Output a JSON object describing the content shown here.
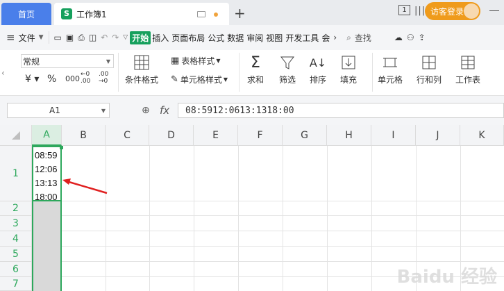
{
  "tabs": {
    "home": "首页",
    "doc_title": "工作簿1"
  },
  "titlebar": {
    "badge": "1",
    "visitor_login": "访客登录"
  },
  "menu": {
    "file": "文件",
    "items": [
      "开始",
      "插入",
      "页面布局",
      "公式",
      "数据",
      "审阅",
      "视图",
      "开发工具",
      "会"
    ],
    "search": "查找"
  },
  "toolbar": {
    "number_format": "常规",
    "conditional_format": "条件格式",
    "table_style": "表格样式",
    "cell_style": "单元格样式",
    "sum": "求和",
    "filter": "筛选",
    "sort": "排序",
    "fill": "填充",
    "cell": "单元格",
    "row_col": "行和列",
    "sheet": "工作表"
  },
  "formula_bar": {
    "cell_ref": "A1",
    "fx": "fx",
    "content": "08:5912:0613:1318:00"
  },
  "grid": {
    "columns": [
      "A",
      "B",
      "C",
      "D",
      "E",
      "F",
      "G",
      "H",
      "I",
      "J",
      "K"
    ],
    "rows": [
      "1",
      "2",
      "3",
      "4",
      "5",
      "6",
      "7"
    ],
    "cell_A1_lines": [
      "08:59",
      "12:06",
      "13:13",
      "18:00"
    ]
  },
  "watermark": "Baidu 经验",
  "colors": {
    "accent_green": "#2da85c",
    "home_tab": "#4a7fea",
    "visitor": "#ef9b1c",
    "arrow": "#e02020"
  }
}
